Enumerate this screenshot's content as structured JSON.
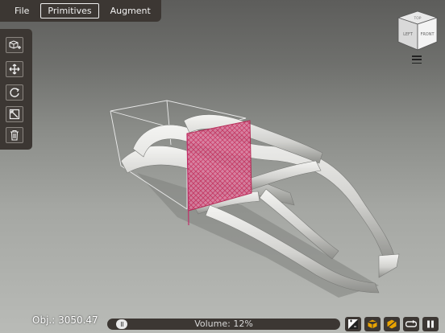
{
  "menubar": {
    "items": [
      {
        "label": "File",
        "active": false
      },
      {
        "label": "Primitives",
        "active": true
      },
      {
        "label": "Augment",
        "active": false
      }
    ]
  },
  "toolbar": {
    "tools": [
      {
        "name": "add-primitive-icon"
      },
      {
        "name": "move-icon"
      },
      {
        "name": "rotate-icon"
      },
      {
        "name": "scale-icon"
      },
      {
        "name": "delete-icon"
      }
    ]
  },
  "viewcube": {
    "top": "TOP",
    "left": "LEFT",
    "front": "FRONT"
  },
  "status": {
    "obj_label": "Obj.: 3050.47",
    "volume_label": "Volume: 12%",
    "volume_fraction": 0.12
  },
  "bottom_buttons": [
    {
      "name": "gradient-toggle-icon"
    },
    {
      "name": "cube-wire-icon"
    },
    {
      "name": "cube-cut-icon"
    },
    {
      "name": "loop-icon"
    },
    {
      "name": "pause-icon"
    }
  ],
  "colors": {
    "panel": "#3c3733",
    "accent_orange": "#e9a300",
    "slice_pink": "#d14a7a"
  }
}
